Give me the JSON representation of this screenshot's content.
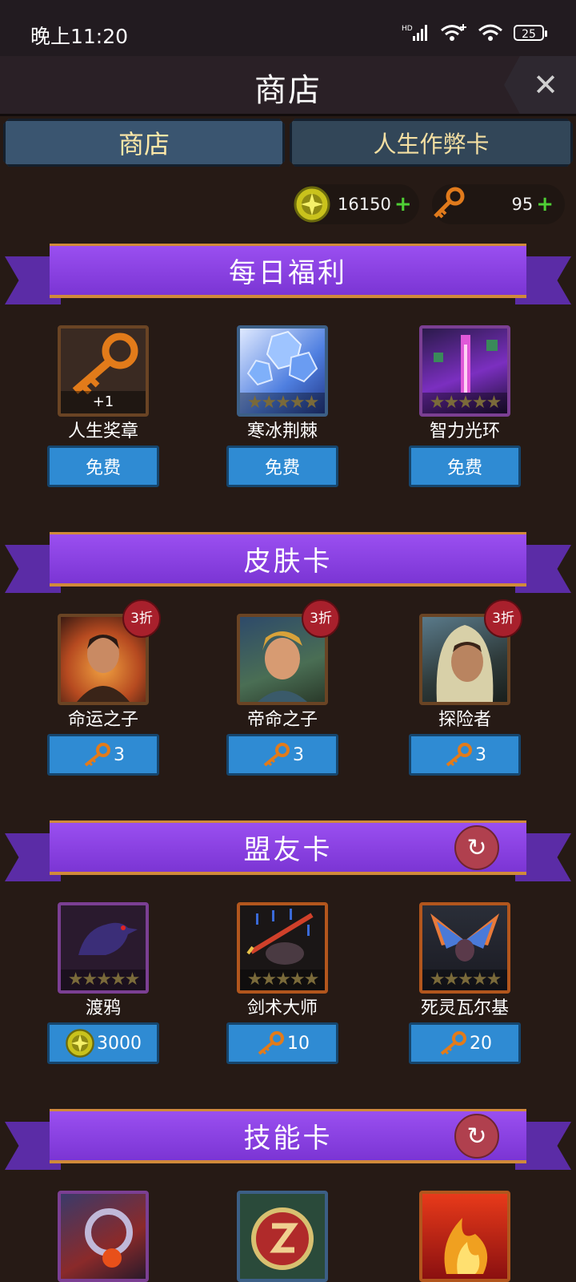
{
  "status": {
    "time": "晚上11:20",
    "battery": "25",
    "network_label": "HD"
  },
  "header": {
    "title": "商店",
    "close": "✕"
  },
  "tabs": [
    {
      "label": "商店"
    },
    {
      "label": "人生作弊卡"
    }
  ],
  "currency": {
    "gold": "16150",
    "keys": "95",
    "plus": "+"
  },
  "sections": {
    "daily": {
      "title": "每日福利",
      "items": [
        {
          "name": "人生奖章",
          "quantity": "+1",
          "price": "免费",
          "icon": "key-icon"
        },
        {
          "name": "寒冰荆棘",
          "stars": "★★★★★",
          "price": "免费",
          "icon": "ice-crystal-icon"
        },
        {
          "name": "智力光环",
          "stars": "★★★★★",
          "price": "免费",
          "icon": "purple-aura-icon"
        }
      ]
    },
    "skins": {
      "title": "皮肤卡",
      "items": [
        {
          "name": "命运之子",
          "badge": "3折",
          "price": "3",
          "icon": "portrait-icon"
        },
        {
          "name": "帝命之子",
          "badge": "3折",
          "price": "3",
          "icon": "portrait-icon"
        },
        {
          "name": "探险者",
          "badge": "3折",
          "price": "3",
          "icon": "portrait-icon"
        }
      ]
    },
    "allies": {
      "title": "盟友卡",
      "refresh": "↻",
      "items": [
        {
          "name": "渡鸦",
          "stars": "★★★★★",
          "price": "3000",
          "currency": "gold",
          "icon": "raven-icon"
        },
        {
          "name": "剑术大师",
          "stars": "★★★★★",
          "price": "10",
          "currency": "key",
          "icon": "swordsman-icon"
        },
        {
          "name": "死灵瓦尔基",
          "stars": "★★★★★",
          "price": "20",
          "currency": "key",
          "icon": "valkyrie-icon"
        }
      ]
    },
    "skills": {
      "title": "技能卡",
      "refresh": "↻",
      "items": [
        {
          "icon": "skill-dark-icon"
        },
        {
          "icon": "skill-lightning-icon"
        },
        {
          "icon": "skill-fire-icon"
        }
      ]
    }
  },
  "colors": {
    "accent_purple": "#8a44e6",
    "price_blue": "#2f8bd3",
    "badge_red": "#a8202c",
    "plus_green": "#4fcf35"
  }
}
